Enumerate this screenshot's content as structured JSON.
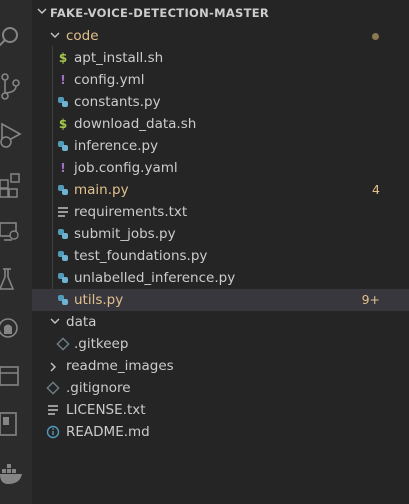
{
  "explorer": {
    "title": "FAKE-VOICE-DETECTION-MASTER",
    "tree": [
      {
        "label": "code",
        "type": "folder",
        "open": true,
        "modified": true,
        "dot": true
      },
      {
        "label": "apt_install.sh",
        "type": "file",
        "icon": "shell-icon",
        "glyph": "$",
        "color": "#a6c94e"
      },
      {
        "label": "config.yml",
        "type": "file",
        "icon": "yaml-icon",
        "glyph": "!",
        "color": "#a074c4"
      },
      {
        "label": "constants.py",
        "type": "file",
        "icon": "python-icon",
        "color": "#519aba"
      },
      {
        "label": "download_data.sh",
        "type": "file",
        "icon": "shell-icon",
        "glyph": "$",
        "color": "#a6c94e"
      },
      {
        "label": "inference.py",
        "type": "file",
        "icon": "python-icon",
        "color": "#519aba"
      },
      {
        "label": "job.config.yaml",
        "type": "file",
        "icon": "yaml-icon",
        "glyph": "!",
        "color": "#a074c4"
      },
      {
        "label": "main.py",
        "type": "file",
        "icon": "python-icon",
        "color": "#519aba",
        "modified": true,
        "badge": "4"
      },
      {
        "label": "requirements.txt",
        "type": "file",
        "icon": "text-lines-icon",
        "color": "#cccccc"
      },
      {
        "label": "submit_jobs.py",
        "type": "file",
        "icon": "python-icon",
        "color": "#519aba"
      },
      {
        "label": "test_foundations.py",
        "type": "file",
        "icon": "python-icon",
        "color": "#519aba"
      },
      {
        "label": "unlabelled_inference.py",
        "type": "file",
        "icon": "python-icon",
        "color": "#519aba"
      },
      {
        "label": "utils.py",
        "type": "file",
        "icon": "python-icon",
        "color": "#519aba",
        "modified": true,
        "badge": "9+",
        "selected": true
      },
      {
        "label": "data",
        "type": "folder",
        "open": true
      },
      {
        "label": ".gitkeep",
        "type": "file",
        "icon": "git-icon",
        "color": "#41535b"
      },
      {
        "label": "readme_images",
        "type": "folder",
        "open": false
      },
      {
        "label": ".gitignore",
        "type": "file",
        "icon": "git-icon",
        "color": "#41535b"
      },
      {
        "label": "LICENSE.txt",
        "type": "file",
        "icon": "text-lines-icon",
        "color": "#cccccc"
      },
      {
        "label": "README.md",
        "type": "file",
        "icon": "info-icon",
        "color": "#519aba"
      }
    ]
  },
  "activity_bar": {
    "icons": [
      "search-icon",
      "source-control-icon",
      "run-debug-icon",
      "extensions-icon",
      "remote-explorer-icon",
      "testing-icon",
      "github-icon",
      "panel-icon",
      "database-icon",
      "docker-icon"
    ]
  },
  "colors": {
    "background": "#252526",
    "activity_bar": "#2c2c2c",
    "selection": "#37373d",
    "modified": "#e2c08d",
    "text": "#cccccc"
  }
}
